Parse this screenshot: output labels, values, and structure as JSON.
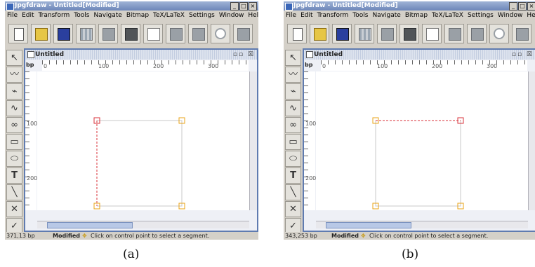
{
  "app_title": "Jpgfdraw - Untitled[Modified]",
  "window_buttons": [
    "_",
    "□",
    "×"
  ],
  "menus": [
    "File",
    "Edit",
    "Transform",
    "Tools",
    "Navigate",
    "Bitmap",
    "TeX/LaTeX",
    "Settings",
    "Window",
    "Help"
  ],
  "toolbar_icons": [
    "new-icon",
    "open-icon",
    "save-icon",
    "grid-icon",
    "grid-settings-icon",
    "dark-grid-icon",
    "check-icon",
    "gray-box-icon",
    "gray-box-icon",
    "undo-icon",
    "gray-box-icon"
  ],
  "left_tools": [
    {
      "icon": "select-icon",
      "glyph": "↖"
    },
    {
      "icon": "open-line-icon",
      "glyph": "〰"
    },
    {
      "icon": "closed-line-icon",
      "glyph": "⌁"
    },
    {
      "icon": "curve-icon",
      "glyph": "∿"
    },
    {
      "icon": "closed-curve-icon",
      "glyph": "∞"
    },
    {
      "icon": "rectangle-icon",
      "glyph": "▭"
    },
    {
      "icon": "ellipse-icon",
      "glyph": "⬭"
    },
    {
      "icon": "text-icon",
      "glyph": "T"
    },
    {
      "icon": "grid-tool-icon",
      "glyph": "╲"
    },
    {
      "icon": "cross-icon",
      "glyph": "✕"
    },
    {
      "icon": "check-tool-icon",
      "glyph": "✓"
    }
  ],
  "doc_title": "Untitled",
  "doc_buttons": "▫▫ ☒",
  "ruler_unit": "bp",
  "ruler_h_labels": [
    "0",
    "100",
    "200",
    "300"
  ],
  "ruler_v_labels": [
    "100",
    "200"
  ],
  "status_mode": "Modified",
  "status_message": "Click on control point to select a segment.",
  "panels": {
    "a": {
      "coords": "371,13 bp",
      "caption": "(a)"
    },
    "b": {
      "coords": "343,253 bp",
      "caption": "(b)"
    }
  },
  "colors": {
    "selected": "#d9303a",
    "control": "#e8a317",
    "path": "#c8c8c8"
  }
}
